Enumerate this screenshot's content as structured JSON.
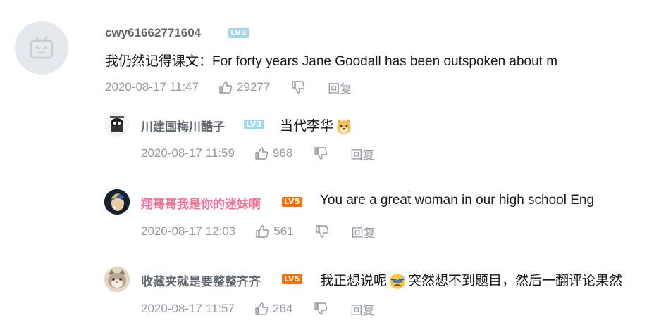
{
  "main_comment": {
    "username": "cwy61662771604",
    "level": "LV3",
    "text": "我仍然记得课文：For forty years Jane Goodall has been outspoken about m",
    "time": "2020-08-17 11:47",
    "likes": "29277",
    "reply_label": "回复"
  },
  "replies": [
    {
      "username": "川建国梅川酷子",
      "level": "LV3",
      "text": "当代李华",
      "time": "2020-08-17 11:59",
      "likes": "968",
      "reply_label": "回复"
    },
    {
      "username": "翔哥哥我是你的迷妹啊",
      "level": "LV5",
      "text": "You are a great woman in our high school Eng",
      "time": "2020-08-17 12:03",
      "likes": "561",
      "reply_label": "回复"
    },
    {
      "username": "收藏夹就是要整整齐齐",
      "level": "LV5",
      "text_before": "我正想说呢",
      "text_after": "突然想不到题目，然后一翻评论果然",
      "time": "2020-08-17 11:57",
      "likes": "264",
      "reply_label": "回复"
    }
  ],
  "colors": {
    "username": "#61666d",
    "vip_username": "#fb7299",
    "meta": "#9499a0",
    "lv3": "#9fd6f0",
    "lv5": "#ff6c00"
  }
}
